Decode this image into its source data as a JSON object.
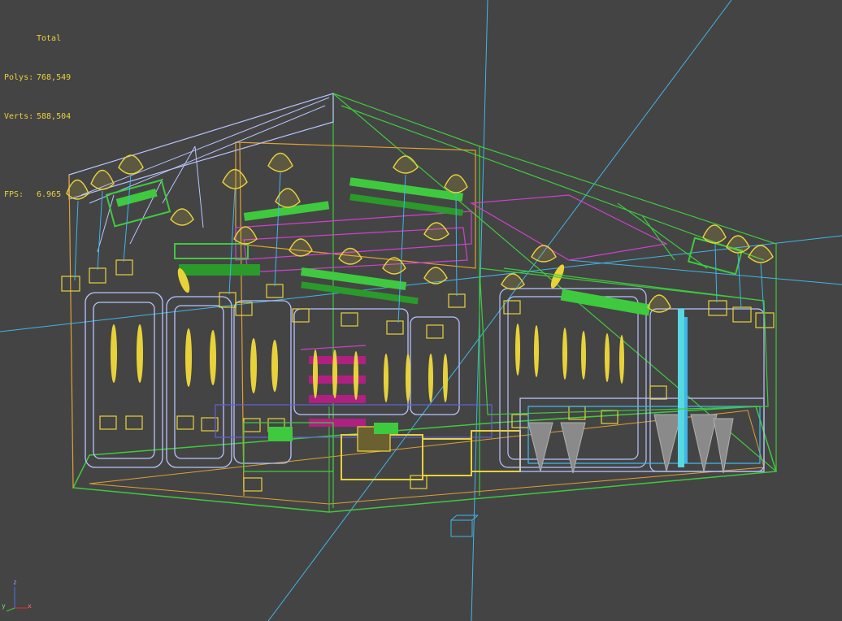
{
  "stats": {
    "header": "Total",
    "polys_label": "Polys:",
    "polys_value": "768,549",
    "verts_label": "Verts:",
    "verts_value": "588,504",
    "fps_label": "FPS:",
    "fps_value": "6.965"
  },
  "axis": {
    "x": "x",
    "y": "y",
    "z": "z"
  },
  "colors": {
    "background": "#444444",
    "stats_text": "#e8d23a",
    "wire_frame": "#b8c4ff",
    "wire_green": "#3fc93f",
    "wire_magenta": "#d040d0",
    "wire_yellow": "#e8d23a",
    "wire_cyan": "#3fb6e8",
    "wire_orange": "#e0a030"
  }
}
